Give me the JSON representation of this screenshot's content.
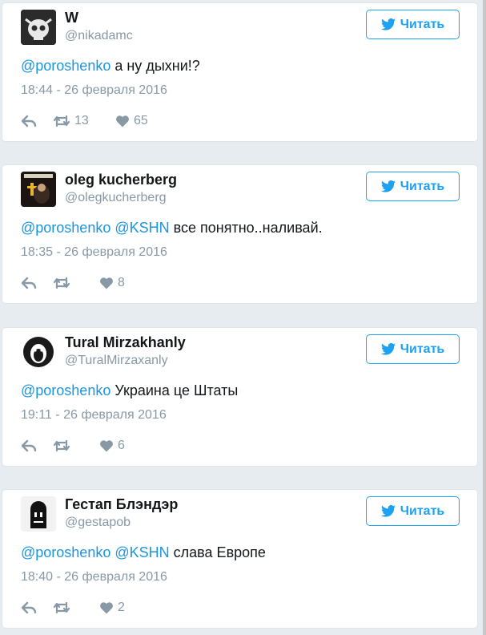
{
  "follow_label": "Читать",
  "colors": {
    "accent": "#1da1f2",
    "mention": "#1b95e0",
    "muted": "#8899a6"
  },
  "tweets": [
    {
      "name": "W",
      "handle": "@nikadamc",
      "mentions": [
        "@poroshenko"
      ],
      "body": "а ну дыхни!?",
      "time": "18:44 - 26 февраля 2016",
      "retweets": "13",
      "likes": "65",
      "avatar": "skull-avatar"
    },
    {
      "name": "oleg kucherberg",
      "handle": "@olegkucherberg",
      "mentions": [
        "@poroshenko",
        "@KSHN"
      ],
      "body": "все понятно..наливай.",
      "time": "18:35 - 26 февраля 2016",
      "retweets": "",
      "likes": "8",
      "avatar": "dark-figure-avatar"
    },
    {
      "name": "Tural Mirzakhanly",
      "handle": "@TuralMirzaxanly",
      "mentions": [
        "@poroshenko"
      ],
      "body": "Украина це Штаты",
      "time": "19:11 - 26 февраля 2016",
      "retweets": "",
      "likes": "6",
      "avatar": "lion-avatar"
    },
    {
      "name": "Гестап Блэндэр",
      "handle": "@gestapob",
      "mentions": [
        "@poroshenko",
        "@KSHN"
      ],
      "body": "слава Европе",
      "time": "18:40 - 26 февраля 2016",
      "retweets": "",
      "likes": "2",
      "avatar": "ghost-avatar"
    }
  ]
}
